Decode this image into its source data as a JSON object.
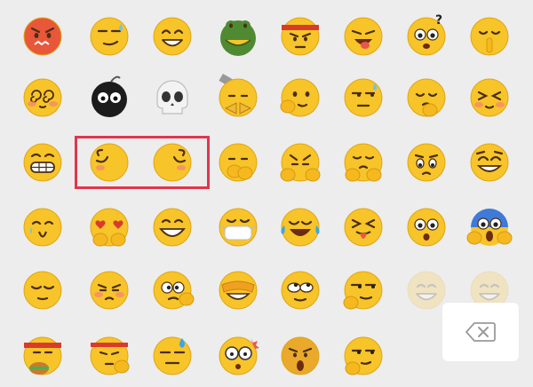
{
  "picker": {
    "background": "#ededed",
    "face_color": "#f7c429",
    "highlight_color": "#e0364c",
    "rows": [
      [
        "angry-red-face",
        "smirk-sweat-face",
        "grin-face",
        "frog-face",
        "headband-angry-face",
        "tongue-out-face",
        "dizzy-question-face",
        "shush-face"
      ],
      [
        "spiral-eyes-face",
        "black-bomb-face",
        "skull-face",
        "hammer-bandage-face",
        "hand-on-cheek-face",
        "sweat-side-eye-face",
        "pleading-hand-face",
        "blushing-squint-face"
      ],
      [
        "toothy-grin-face",
        "face-turned-left",
        "face-turned-right",
        "face-palm-face",
        "drool-face",
        "worried-hands-face",
        "sad-eyes-face",
        "smug-wink-face"
      ],
      [
        "teary-grin-face",
        "heart-eyes-paws-face",
        "big-grin-face",
        "mask-face",
        "tears-of-joy-face",
        "squint-tongue-face",
        "surprised-face",
        "screaming-face"
      ],
      [
        "relieved-face",
        "tsk-face",
        "dizzy-hand-face",
        "hand-over-eyes-face",
        "eye-roll-face",
        "side-eye-hand-face",
        "faded-face-1",
        "faded-face-2"
      ],
      [
        "burger-headband-face",
        "headband-flex-face",
        "cold-sweat-flat-face",
        "glasses-surprise-face",
        "kiss-face",
        "thinking-chin-face",
        "",
        ""
      ]
    ],
    "highlighted": [
      "face-turned-left",
      "face-turned-right"
    ],
    "faded": [
      "faded-face-1",
      "faded-face-2"
    ],
    "backspace_icon": "backspace-icon"
  }
}
